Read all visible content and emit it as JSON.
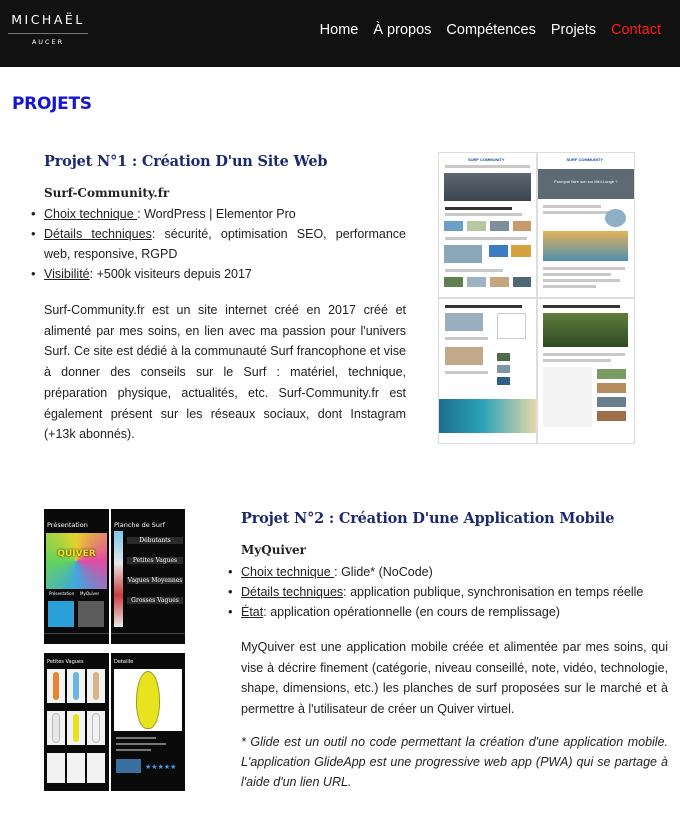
{
  "header": {
    "logo_top": "MICHAËL",
    "logo_bottom": "AUCER",
    "nav": [
      {
        "label": "Home"
      },
      {
        "label": "À propos"
      },
      {
        "label": "Compétences"
      },
      {
        "label": "Projets"
      },
      {
        "label": "Contact"
      }
    ],
    "active_color": "#ff1a1a"
  },
  "section_title": "PROJETS",
  "projects": [
    {
      "title": "Projet N°1 : Création D'un Site Web",
      "subtitle": "Surf-Community.fr",
      "bullets": [
        {
          "label": "Choix technique ",
          "text": ": WordPress | Elementor Pro"
        },
        {
          "label": "Détails techniques",
          "text": ": sécurité, optimisation SEO, performance web, responsive, RGPD"
        },
        {
          "label": "Visibilité",
          "text": ": +500k visiteurs depuis 2017"
        }
      ],
      "paragraph": "Surf-Community.fr est un site internet créé en 2017 créé et alimenté par mes soins, en lien avec ma passion pour l'univers Surf. Ce site est dédié à la communauté Surf francophone et vise à donner des conseils sur le Surf : matériel, technique, préparation physique, actualités, etc. Surf-Community.fr est également présent sur les réseaux sociaux, dont Instagram (+13k abonnés).",
      "image": {
        "shot1_brand": "SURF COMMUNITY",
        "shot2_brand": "SURF COMMUNITY",
        "shot2_headline": "Pourquoi faire son sur Mini-Longb ?"
      }
    },
    {
      "title": "Projet N°2 : Création D'une Application Mobile",
      "subtitle": "MyQuiver",
      "bullets": [
        {
          "label": "Choix technique ",
          "text": ": Glide* (NoCode)"
        },
        {
          "label": "Détails techniques",
          "text": ": application publique, synchronisation en temps réelle"
        },
        {
          "label": "État",
          "text": ": application opérationnelle (en cours de remplissage)"
        }
      ],
      "paragraph": "MyQuiver est une application mobile créée et alimentée par mes soins, qui vise à décrire finement (catégorie, niveau conseillé, note, vidéo, technologie, shape, dimensions, etc.) les planches de surf proposées sur le marché et à permettre à l'utilisateur de créer un Quiver virtuel.",
      "note": "* Glide est un outil no code permettant la création d'une application mobile. L'application GlideApp est une progressive web app (PWA) qui se partage à l'aide d'un lien URL.",
      "image": {
        "phone1_title": "Présentation",
        "phone1_logo": "QUIVER",
        "phone1_links": [
          "Présentation",
          "MyQuiver"
        ],
        "phone2_title": "Planche de Surf",
        "phone2_categories": [
          "Débutants",
          "Petites Vagues",
          "Vagues Moyennes",
          "Grosses Vagues"
        ],
        "phone3_title": "Petites Vagues",
        "phone4_title": "Detaille",
        "phone4_rating": "★★★★★"
      }
    }
  ]
}
